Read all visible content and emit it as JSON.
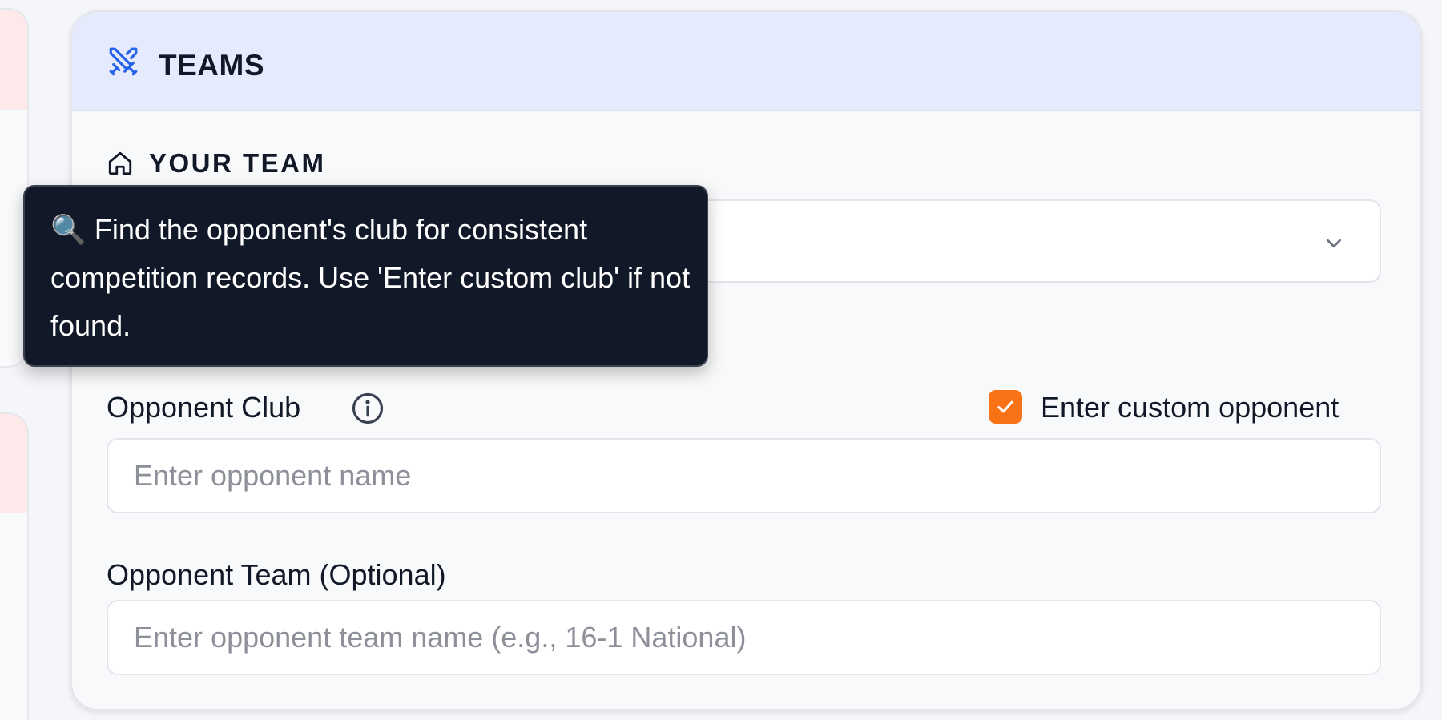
{
  "teams_card": {
    "title": "TEAMS",
    "header_icon": "crossed-swords-icon",
    "your_team": {
      "section_title": "YOUR TEAM",
      "section_icon": "home-icon",
      "select_value": "",
      "select_icon": "chevron-down-icon"
    },
    "opponent_club": {
      "label": "Opponent Club",
      "info_icon": "info-icon",
      "custom_checkbox_label": "Enter custom opponent",
      "custom_checkbox_checked": true,
      "input_value": "",
      "input_placeholder": "Enter opponent name"
    },
    "opponent_team": {
      "label": "Opponent Team (Optional)",
      "input_value": "",
      "input_placeholder": "Enter opponent team name (e.g., 16-1 National)"
    }
  },
  "tooltip": {
    "text": "🔍 Find the opponent's club for consistent competition records. Use 'Enter custom club' if not found."
  },
  "colors": {
    "header_bg": "#e6eafd",
    "accent_blue": "#2563eb",
    "checkbox_orange": "#f97316",
    "tooltip_bg": "#111827",
    "left_card_tint": "#fde8ea"
  }
}
